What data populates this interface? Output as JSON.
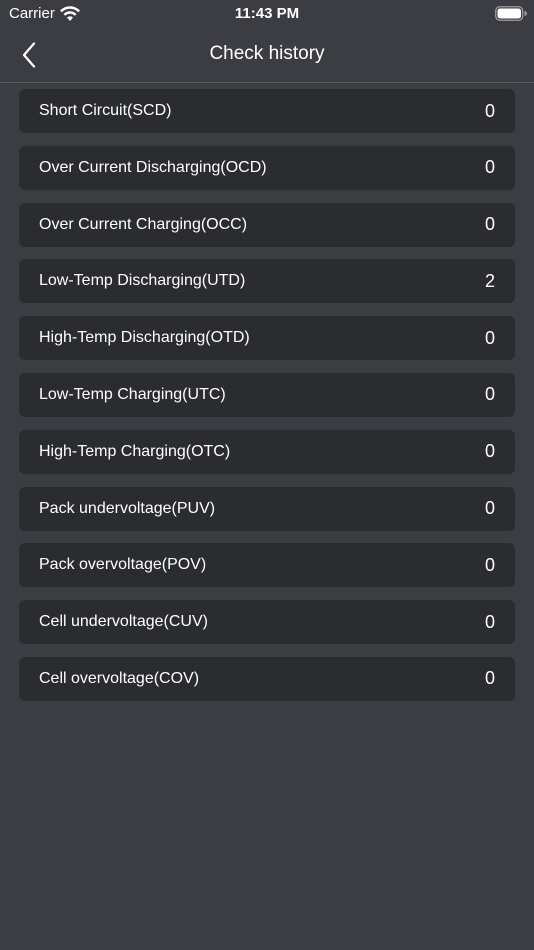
{
  "status_bar": {
    "carrier": "Carrier",
    "time": "11:43 PM"
  },
  "nav": {
    "title": "Check history",
    "back_icon": "chevron-left-icon"
  },
  "records": [
    {
      "label": "Short Circuit(SCD)",
      "count": "0"
    },
    {
      "label": "Over Current Discharging(OCD)",
      "count": "0"
    },
    {
      "label": "Over Current Charging(OCC)",
      "count": "0"
    },
    {
      "label": "Low-Temp Discharging(UTD)",
      "count": "2"
    },
    {
      "label": "High-Temp Discharging(OTD)",
      "count": "0"
    },
    {
      "label": "Low-Temp Charging(UTC)",
      "count": "0"
    },
    {
      "label": "High-Temp Charging(OTC)",
      "count": "0"
    },
    {
      "label": "Pack undervoltage(PUV)",
      "count": "0"
    },
    {
      "label": "Pack overvoltage(POV)",
      "count": "0"
    },
    {
      "label": "Cell undervoltage(CUV)",
      "count": "0"
    },
    {
      "label": "Cell overvoltage(COV)",
      "count": "0"
    }
  ],
  "colors": {
    "background": "#3c3d42",
    "row_background": "#2b2c30",
    "text": "#ffffff"
  }
}
